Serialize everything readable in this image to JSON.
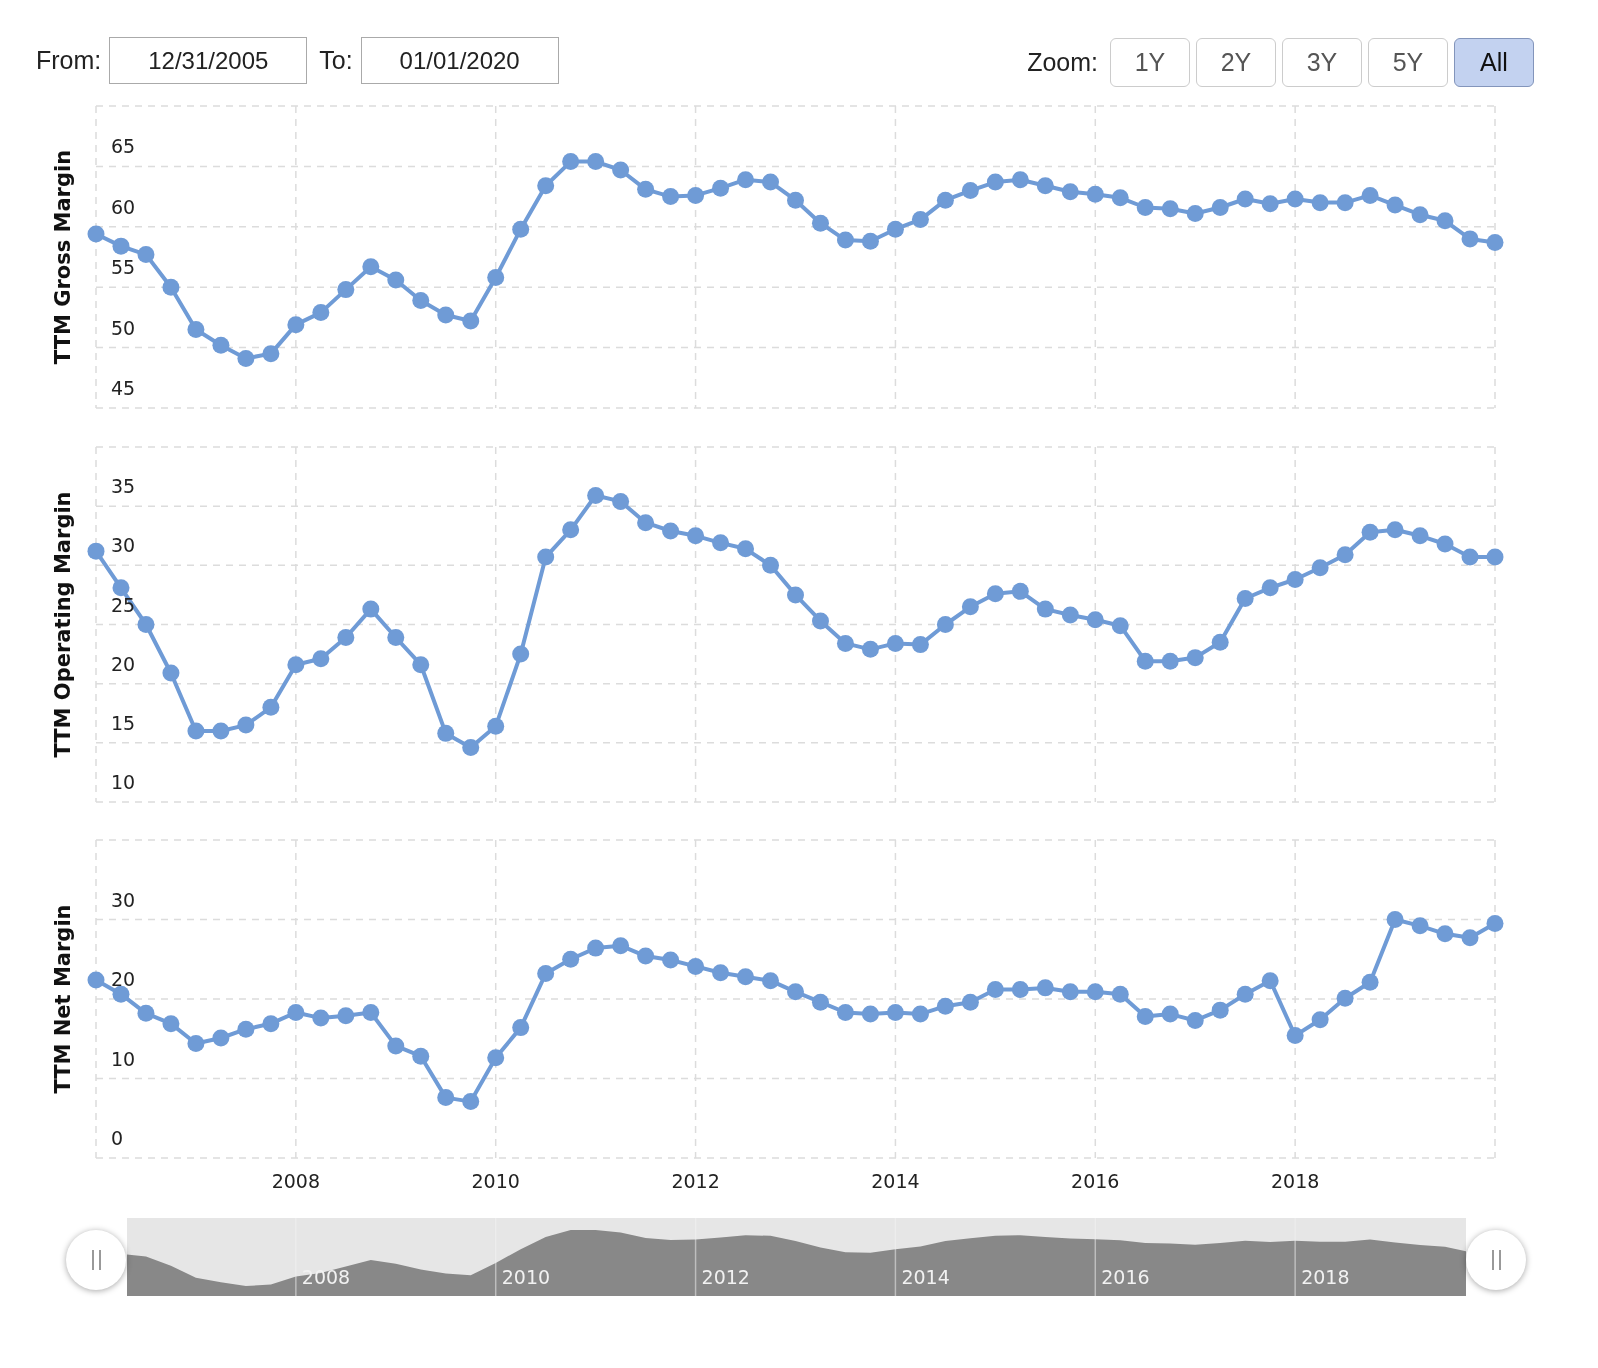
{
  "range": {
    "from_label": "From:",
    "from_value": "12/31/2005",
    "to_label": "To:",
    "to_value": "01/01/2020"
  },
  "zoom": {
    "label": "Zoom:",
    "buttons": [
      {
        "label": "1Y",
        "selected": false
      },
      {
        "label": "2Y",
        "selected": false
      },
      {
        "label": "3Y",
        "selected": false
      },
      {
        "label": "5Y",
        "selected": false
      },
      {
        "label": "All",
        "selected": true
      }
    ]
  },
  "charts": [
    {
      "chart_data": {
        "type": "line",
        "grid": true,
        "ylabel": "TTM Gross Margin",
        "xlim": [
          2006,
          2020
        ],
        "ylim": [
          45,
          70
        ],
        "yticks": [
          45,
          50,
          55,
          60,
          65
        ],
        "x": [
          2006,
          2006.25,
          2006.5,
          2006.75,
          2007,
          2007.25,
          2007.5,
          2007.75,
          2008,
          2008.25,
          2008.5,
          2008.75,
          2009,
          2009.25,
          2009.5,
          2009.75,
          2010,
          2010.25,
          2010.5,
          2010.75,
          2011,
          2011.25,
          2011.5,
          2011.75,
          2012,
          2012.25,
          2012.5,
          2012.75,
          2013,
          2013.25,
          2013.5,
          2013.75,
          2014,
          2014.25,
          2014.5,
          2014.75,
          2015,
          2015.25,
          2015.5,
          2015.75,
          2016,
          2016.25,
          2016.5,
          2016.75,
          2017,
          2017.25,
          2017.5,
          2017.75,
          2018,
          2018.25,
          2018.5,
          2018.75,
          2019,
          2019.25,
          2019.5,
          2019.75,
          2020
        ],
        "series": [
          {
            "color": "#6f9bd6",
            "marker": true,
            "values": [
              59.4,
              58.4,
              57.7,
              55.0,
              51.5,
              50.2,
              49.1,
              49.5,
              51.9,
              52.9,
              54.8,
              56.7,
              55.6,
              53.9,
              52.7,
              52.2,
              55.8,
              59.8,
              63.4,
              65.4,
              65.4,
              64.7,
              63.1,
              62.5,
              62.6,
              63.2,
              63.9,
              63.7,
              62.2,
              60.3,
              58.9,
              58.8,
              59.8,
              60.6,
              62.2,
              63.0,
              63.7,
              63.9,
              63.4,
              62.9,
              62.7,
              62.4,
              61.6,
              61.5,
              61.1,
              61.6,
              62.3,
              61.9,
              62.3,
              62.0,
              62.0,
              62.6,
              61.8,
              61.0,
              60.5,
              59.0,
              58.7
            ]
          }
        ]
      }
    },
    {
      "chart_data": {
        "type": "line",
        "grid": true,
        "ylabel": "TTM Operating Margin",
        "xlim": [
          2006,
          2020
        ],
        "ylim": [
          10,
          40
        ],
        "yticks": [
          10,
          15,
          20,
          25,
          30,
          35
        ],
        "x": [
          2006,
          2006.25,
          2006.5,
          2006.75,
          2007,
          2007.25,
          2007.5,
          2007.75,
          2008,
          2008.25,
          2008.5,
          2008.75,
          2009,
          2009.25,
          2009.5,
          2009.75,
          2010,
          2010.25,
          2010.5,
          2010.75,
          2011,
          2011.25,
          2011.5,
          2011.75,
          2012,
          2012.25,
          2012.5,
          2012.75,
          2013,
          2013.25,
          2013.5,
          2013.75,
          2014,
          2014.25,
          2014.5,
          2014.75,
          2015,
          2015.25,
          2015.5,
          2015.75,
          2016,
          2016.25,
          2016.5,
          2016.75,
          2017,
          2017.25,
          2017.5,
          2017.75,
          2018,
          2018.25,
          2018.5,
          2018.75,
          2019,
          2019.25,
          2019.5,
          2019.75,
          2020
        ],
        "series": [
          {
            "color": "#6f9bd6",
            "marker": true,
            "values": [
              31.2,
              28.1,
              25.0,
              20.9,
              16.0,
              16.0,
              16.5,
              18.0,
              21.6,
              22.1,
              23.9,
              26.3,
              23.9,
              21.6,
              15.8,
              14.6,
              16.4,
              22.5,
              30.7,
              33.0,
              35.9,
              35.4,
              33.6,
              32.9,
              32.5,
              31.9,
              31.4,
              30.0,
              27.5,
              25.3,
              23.4,
              22.9,
              23.4,
              23.3,
              25.0,
              26.5,
              27.6,
              27.8,
              26.3,
              25.8,
              25.4,
              24.9,
              21.9,
              21.9,
              22.2,
              23.5,
              27.2,
              28.1,
              28.8,
              29.8,
              30.9,
              32.8,
              33.0,
              32.5,
              31.8,
              30.7,
              30.7
            ]
          }
        ]
      }
    },
    {
      "chart_data": {
        "type": "line",
        "grid": true,
        "ylabel": "TTM Net Margin",
        "xlim": [
          2006,
          2020
        ],
        "ylim": [
          0,
          40
        ],
        "yticks": [
          0,
          10,
          20,
          30
        ],
        "xticks": [
          {
            "value": 2008,
            "label": "2008"
          },
          {
            "value": 2010,
            "label": "2010"
          },
          {
            "value": 2012,
            "label": "2012"
          },
          {
            "value": 2014,
            "label": "2014"
          },
          {
            "value": 2016,
            "label": "2016"
          },
          {
            "value": 2018,
            "label": "2018"
          }
        ],
        "x": [
          2006,
          2006.25,
          2006.5,
          2006.75,
          2007,
          2007.25,
          2007.5,
          2007.75,
          2008,
          2008.25,
          2008.5,
          2008.75,
          2009,
          2009.25,
          2009.5,
          2009.75,
          2010,
          2010.25,
          2010.5,
          2010.75,
          2011,
          2011.25,
          2011.5,
          2011.75,
          2012,
          2012.25,
          2012.5,
          2012.75,
          2013,
          2013.25,
          2013.5,
          2013.75,
          2014,
          2014.25,
          2014.5,
          2014.75,
          2015,
          2015.25,
          2015.5,
          2015.75,
          2016,
          2016.25,
          2016.5,
          2016.75,
          2017,
          2017.25,
          2017.5,
          2017.75,
          2018,
          2018.25,
          2018.5,
          2018.75,
          2019,
          2019.25,
          2019.5,
          2019.75,
          2020
        ],
        "series": [
          {
            "color": "#6f9bd6",
            "marker": true,
            "values": [
              22.4,
              20.6,
              18.2,
              16.9,
              14.4,
              15.1,
              16.2,
              16.9,
              18.3,
              17.6,
              17.9,
              18.3,
              14.1,
              12.8,
              7.6,
              7.1,
              12.6,
              16.4,
              23.2,
              25.0,
              26.4,
              26.7,
              25.4,
              24.9,
              24.1,
              23.3,
              22.8,
              22.3,
              20.9,
              19.6,
              18.3,
              18.1,
              18.3,
              18.1,
              19.1,
              19.6,
              21.2,
              21.2,
              21.4,
              20.9,
              20.9,
              20.6,
              17.8,
              18.1,
              17.3,
              18.6,
              20.6,
              22.3,
              15.4,
              17.4,
              20.1,
              22.1,
              30.0,
              29.2,
              28.2,
              27.7,
              29.5
            ]
          }
        ]
      }
    }
  ],
  "navigator": {
    "labels": [
      "2008",
      "2010",
      "2012",
      "2014",
      "2016",
      "2018"
    ]
  }
}
